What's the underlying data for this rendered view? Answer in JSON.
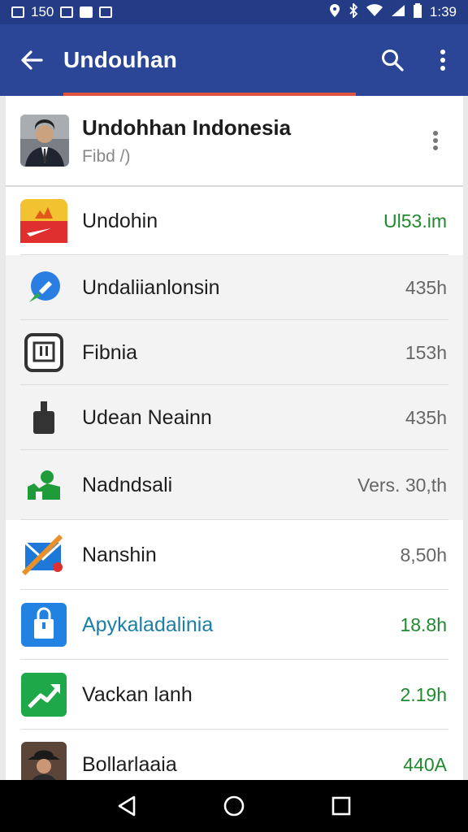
{
  "status_bar": {
    "time": "1:39",
    "left_text": "150"
  },
  "app_bar": {
    "title": "Undouhan"
  },
  "account": {
    "name": "Undohhan Indonesia",
    "subtitle": "Fibd /)"
  },
  "apps": [
    {
      "name": "Undohin",
      "size": "Ul53.im",
      "icon": "flag-icon",
      "size_color": "green",
      "shade": "white"
    },
    {
      "name": "Undaliianlonsin",
      "size": "435h",
      "icon": "pen-icon",
      "size_color": "gray",
      "shade": "gray"
    },
    {
      "name": "Fibnia",
      "size": "153h",
      "icon": "tablet-icon",
      "size_color": "gray",
      "shade": "gray"
    },
    {
      "name": "Udean Neainn",
      "size": "435h",
      "icon": "bottle-icon",
      "size_color": "gray",
      "shade": "gray"
    },
    {
      "name": "Nadndsali",
      "size": "Vers. 30,th",
      "icon": "users-icon",
      "size_color": "gray",
      "shade": "gray"
    },
    {
      "name": "Nanshin",
      "size": "8,50h",
      "icon": "mail-icon",
      "size_color": "gray",
      "shade": "white"
    },
    {
      "name": "Apykaladalinia",
      "size": "18.8h",
      "icon": "bag-icon",
      "size_color": "green",
      "shade": "white"
    },
    {
      "name": "Vackan lanh",
      "size": "2.19h",
      "icon": "trend-icon",
      "size_color": "green",
      "shade": "white"
    },
    {
      "name": "Bollarlaaia",
      "size": "440A",
      "icon": "avatar-hat-icon",
      "size_color": "green",
      "shade": "white"
    }
  ],
  "colors": {
    "app_bar": "#2b4696",
    "accent": "#e0533e",
    "green": "#1f8a2e"
  }
}
